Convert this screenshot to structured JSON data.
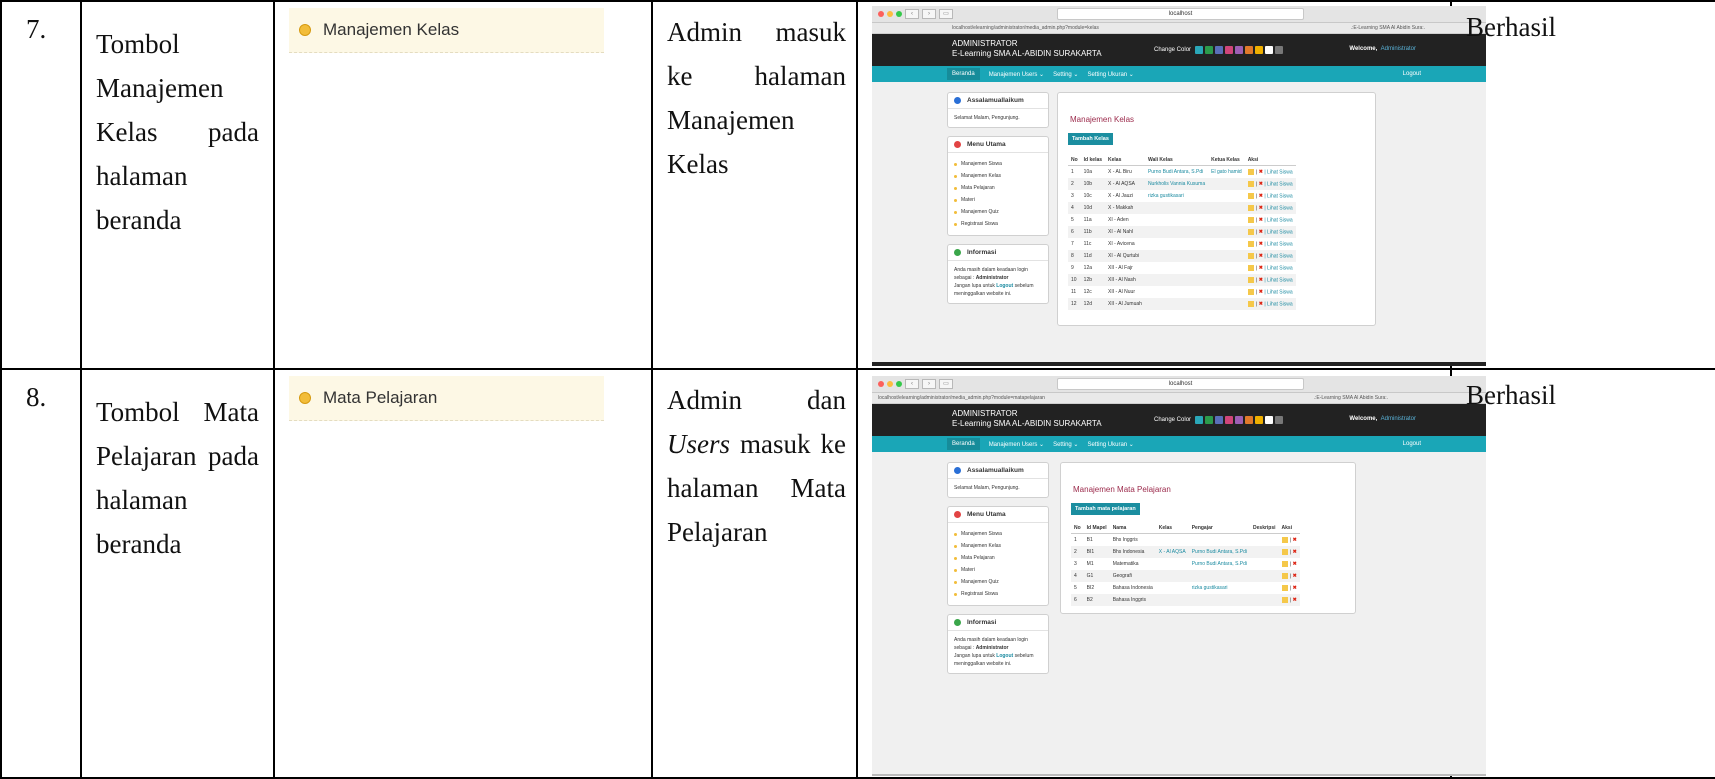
{
  "rows": [
    {
      "no": "7.",
      "description": "Tombol Manajemen Kelas pada halaman beranda",
      "crop_label": "Manajemen Kelas",
      "result_parts": [
        "Admin masuk ke halaman Manajemen Kelas"
      ],
      "status": "Berhasil",
      "screenshot": {
        "url": "localhost",
        "tab_left": "localhost/elearning/administrator/media_admin.php?module=kelas",
        "tab_right": ".:E-Learning SMA Al Abidin Sura:.",
        "brand_line1": "ADMINISTRATOR",
        "brand_line2": "E-Learning SMA AL-ABIDIN SURAKARTA",
        "change_color": "Change Color",
        "welcome": "Welcome,",
        "welcome_user": "Administrator",
        "nav": [
          "Beranda",
          "Manajemen Users ⌄",
          "Setting ⌄",
          "Setting Ukuran ⌄"
        ],
        "logout": "Logout",
        "box1_title": "Assalamuallaikum",
        "box1_text": "Selamat Malam, Pengunjung.",
        "box2_title": "Menu Utama",
        "menu": [
          "Manajemen Siswa",
          "Manajemen Kelas",
          "Mata Pelajaran",
          "Materi",
          "Manajemen Quiz",
          "Registrasi Siswa"
        ],
        "box3_title": "Informasi",
        "info_1": "Anda masih dalam keadaan login sebagai :",
        "info_bold": "Administrator",
        "info_2": "Jangan lupa untuk",
        "info_logout": "Logout",
        "info_3": "sebelum meninggalkan website ini.",
        "main_title": "Manajemen Kelas",
        "add_button": "Tambah Kelas",
        "columns": [
          "No",
          "Id kelas",
          "Kelas",
          "Wali Kelas",
          "Ketua Kelas",
          "Aksi"
        ],
        "table": [
          [
            "1",
            "10a",
            "X - AL Biru",
            "Purno Budi Antara, S.Pdi",
            "El gato hamid"
          ],
          [
            "2",
            "10b",
            "X - Al AQSA",
            "Nurkholis Vannia Kusuma",
            ""
          ],
          [
            "3",
            "10c",
            "X - Al Jauzi",
            "rizka gustikasari",
            ""
          ],
          [
            "4",
            "10d",
            "X - Makkah",
            "",
            ""
          ],
          [
            "5",
            "11a",
            "XI - Aden",
            "",
            ""
          ],
          [
            "6",
            "11b",
            "XI - Al Nahl",
            "",
            ""
          ],
          [
            "7",
            "11c",
            "XI - Avicena",
            "",
            ""
          ],
          [
            "8",
            "11d",
            "XI - Al Qurtubi",
            "",
            ""
          ],
          [
            "9",
            "12a",
            "XII - Al Fajr",
            "",
            ""
          ],
          [
            "10",
            "12b",
            "XII - Al Nash",
            "",
            ""
          ],
          [
            "11",
            "12c",
            "XII - Al Nuur",
            "",
            ""
          ],
          [
            "12",
            "12d",
            "XII - Al Jumuah",
            "",
            ""
          ]
        ],
        "action_link": "| Lihat Siswa"
      }
    },
    {
      "no": "8.",
      "description": "Tombol Mata Pelajaran pada halaman beranda",
      "crop_label": "Mata Pelajaran",
      "result_a": "Admin dan",
      "result_italic": "Users",
      "result_b": "masuk ke halaman Mata Pelajaran",
      "status": "Berhasil",
      "screenshot": {
        "url": "localhost",
        "tab_left": "localhost/elearning/administrator/media_admin.php?module=matapelajaran",
        "tab_right": ".:E-Learning SMA Al Abidin Sura:.",
        "brand_line1": "ADMINISTRATOR",
        "brand_line2": "E-Learning SMA AL-ABIDIN SURAKARTA",
        "change_color": "Change Color",
        "welcome": "Welcome,",
        "welcome_user": "Administrator",
        "nav": [
          "Beranda",
          "Manajemen Users ⌄",
          "Setting ⌄",
          "Setting Ukuran ⌄"
        ],
        "logout": "Logout",
        "box1_title": "Assalamuallaikum",
        "box1_text": "Selamat Malam, Pengunjung.",
        "box2_title": "Menu Utama",
        "menu": [
          "Manajemen Siswa",
          "Manajemen Kelas",
          "Mata Pelajaran",
          "Materi",
          "Manajemen Quiz",
          "Registrasi Siswa"
        ],
        "box3_title": "Informasi",
        "info_1": "Anda masih dalam keadaan login sebagai :",
        "info_bold": "Administrator",
        "info_2": "Jangan lupa untuk",
        "info_logout": "Logout",
        "info_3": "sebelum meninggalkan website ini.",
        "main_title": "Manajemen Mata Pelajaran",
        "add_button": "Tambah mata pelajaran",
        "columns": [
          "No",
          "Id Mapel",
          "Nama",
          "Kelas",
          "Pengajar",
          "Deskripsi",
          "Aksi"
        ],
        "table": [
          [
            "1",
            "B1",
            "Bhs Inggris",
            "",
            ""
          ],
          [
            "2",
            "BI1",
            "Bhs Indonesia",
            "X - Al AQSA",
            "Purno Budi Antara, S.Pdi"
          ],
          [
            "3",
            "M1",
            "Matematika",
            "",
            "Purno Budi Antara, S.Pdi"
          ],
          [
            "4",
            "G1",
            "Geografi",
            "",
            ""
          ],
          [
            "5",
            "BI2",
            "Bahasa Indonesia",
            "",
            "rizka gustikasari"
          ],
          [
            "6",
            "B2",
            "Bahasa Inggris",
            "",
            ""
          ]
        ]
      }
    }
  ],
  "colors": {
    "topbar": "#222222",
    "teal": "#1aa6b7",
    "title_red": "#9c2b4c",
    "swatches": [
      "#2aa7b8",
      "#2c9b4b",
      "#5a6fb8",
      "#d0457a",
      "#9d5fb5",
      "#e07a2b",
      "#f0b000",
      "#ffffff",
      "#777777"
    ]
  }
}
